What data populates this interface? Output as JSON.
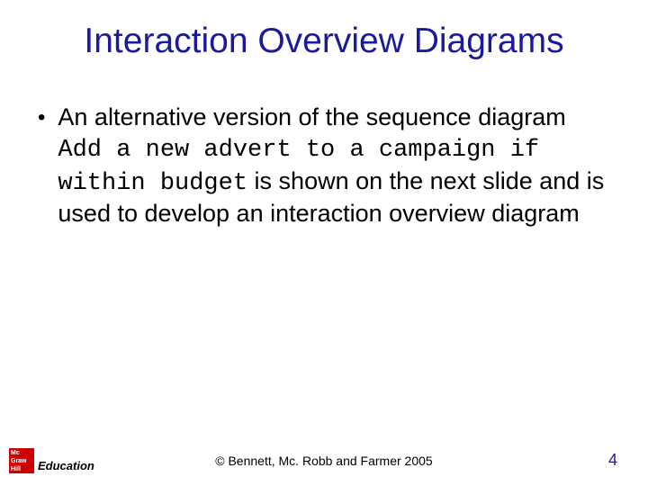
{
  "title": "Interaction Overview Diagrams",
  "bullet": {
    "lead": "An alternative version of the sequence diagram ",
    "code": "Add a new advert to a campaign if within budget",
    "tail": " is shown on the next slide and is used to develop an interaction overview diagram"
  },
  "footer": {
    "copyright": "©  Bennett, Mc. Robb and Farmer 2005",
    "page": "4",
    "logo": {
      "line1": "Mc",
      "line2": "Graw",
      "line3": "Hill",
      "edu": "Education"
    }
  }
}
